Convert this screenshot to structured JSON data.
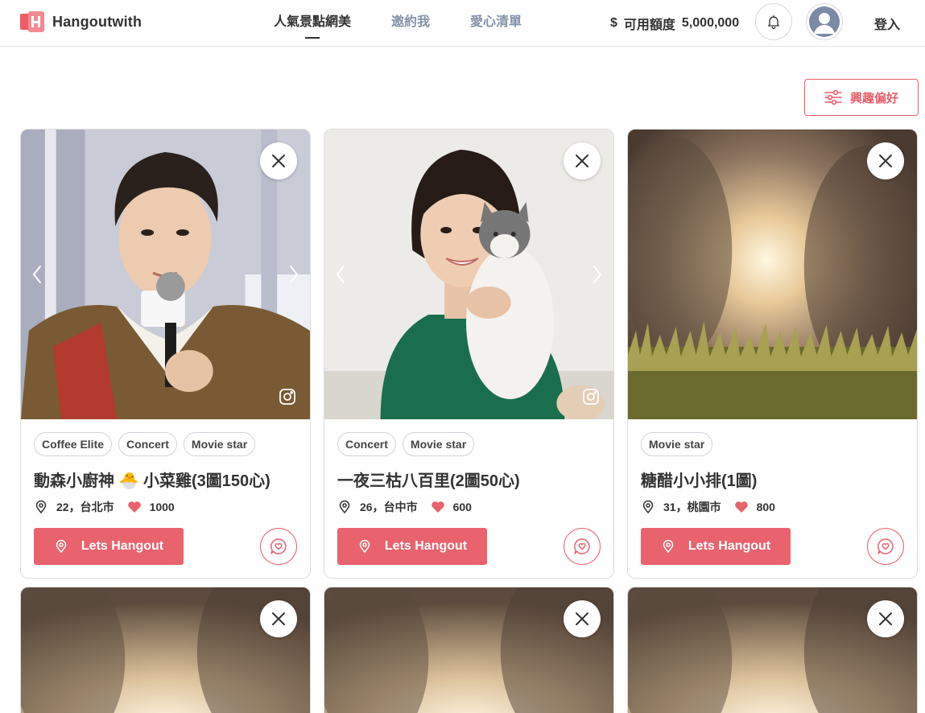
{
  "header": {
    "brand": "Hangoutwith",
    "nav": [
      {
        "label": "人氣景點網美",
        "active": true
      },
      {
        "label": "邀約我",
        "active": false
      },
      {
        "label": "愛心清單",
        "active": false
      }
    ],
    "credit_symbol": "$",
    "credit_label": "可用額度",
    "credit_value": "5,000,000",
    "login_label": "登入"
  },
  "filter_label": "興趣偏好",
  "cards": [
    {
      "tags": [
        "Coffee Elite",
        "Concert",
        "Movie star"
      ],
      "title": "動森小廚神 🐣 小菜雞(3圖150心)",
      "location": "22，台北市",
      "likes": "1000",
      "button_label": "Lets Hangout"
    },
    {
      "tags": [
        "Concert",
        "Movie star"
      ],
      "title": "一夜三枯八百里(2圖50心)",
      "location": "26，台中市",
      "likes": "600",
      "button_label": "Lets Hangout"
    },
    {
      "tags": [
        "Movie star"
      ],
      "title": "糖醋小小排(1圖)",
      "location": "31，桃園市",
      "likes": "800",
      "button_label": "Lets Hangout"
    }
  ],
  "colors": {
    "accent": "#e8636e",
    "nav_inactive": "#8593a8",
    "text": "#333333"
  }
}
